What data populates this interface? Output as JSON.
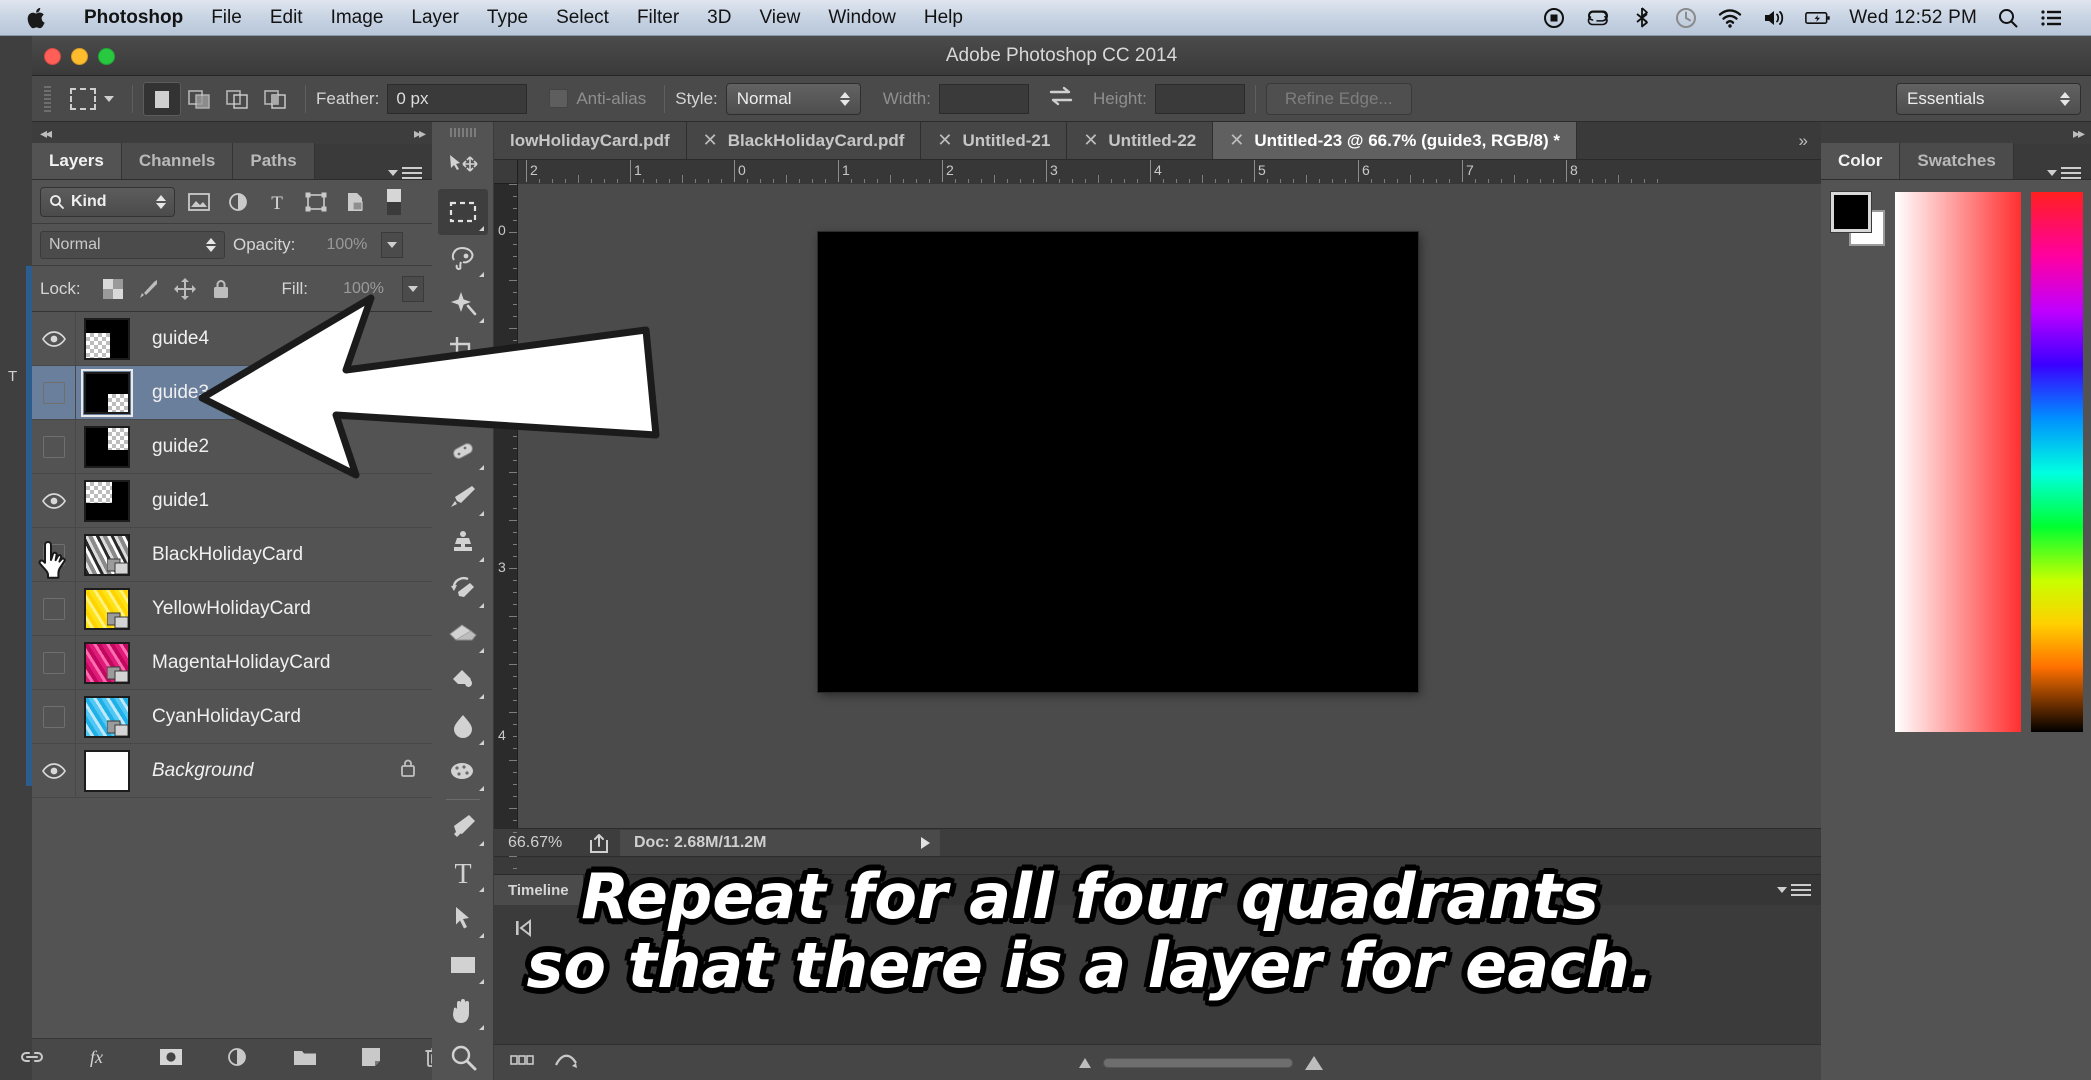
{
  "menubar": {
    "apple_icon": "apple-logo-icon",
    "items": [
      {
        "label": "Photoshop",
        "bold": true
      },
      {
        "label": "File",
        "bold": false
      },
      {
        "label": "Edit",
        "bold": false
      },
      {
        "label": "Image",
        "bold": false
      },
      {
        "label": "Layer",
        "bold": false
      },
      {
        "label": "Type",
        "bold": false
      },
      {
        "label": "Select",
        "bold": false
      },
      {
        "label": "Filter",
        "bold": false
      },
      {
        "label": "3D",
        "bold": false
      },
      {
        "label": "View",
        "bold": false
      },
      {
        "label": "Window",
        "bold": false
      },
      {
        "label": "Help",
        "bold": false
      }
    ],
    "status_icons": [
      "screen-record-icon",
      "creative-cloud-icon",
      "bluetooth-icon",
      "time-machine-icon",
      "wifi-icon",
      "volume-icon",
      "battery-icon"
    ],
    "clock": "Wed 12:52 PM",
    "search_icon": "spotlight-search-icon",
    "notifications_icon": "notification-center-icon"
  },
  "window": {
    "title": "Adobe Photoshop CC 2014",
    "close_label": "close",
    "minimize_label": "minimize",
    "zoom_label": "zoom"
  },
  "options_bar": {
    "tool_icon": "rectangular-marquee-icon",
    "tool_preset_caret": "chevron-down-icon",
    "selection_modes": [
      "new-selection-icon",
      "add-to-selection-icon",
      "subtract-from-selection-icon",
      "intersect-selection-icon"
    ],
    "feather_label": "Feather:",
    "feather_value": "0 px",
    "antialias_label": "Anti-alias",
    "antialias_checked": false,
    "style_label": "Style:",
    "style_value": "Normal",
    "width_label": "Width:",
    "width_value": "",
    "swap_icon": "swap-width-height-icon",
    "height_label": "Height:",
    "height_value": "",
    "refine_edge_label": "Refine Edge...",
    "workspace_value": "Essentials"
  },
  "layers_panel": {
    "collapse_left_icon": "collapse-left-icon",
    "expand_right_icon": "expand-right-icon",
    "tabs": [
      {
        "label": "Layers",
        "active": true
      },
      {
        "label": "Channels",
        "active": false
      },
      {
        "label": "Paths",
        "active": false
      }
    ],
    "menu_icon": "panel-menu-icon",
    "filter": {
      "kind_label": "Kind",
      "search_icon": "search-icon",
      "icons": [
        "pixel-layer-filter-icon",
        "adjustment-layer-filter-icon",
        "type-layer-filter-icon",
        "shape-layer-filter-icon",
        "smart-object-filter-icon"
      ],
      "toggle_icon": "filter-toggle-icon"
    },
    "blend_mode": "Normal",
    "opacity_label": "Opacity:",
    "opacity_value": "100%",
    "lock_label": "Lock:",
    "lock_icons": [
      "lock-transparency-icon",
      "lock-image-pixels-icon",
      "lock-position-icon",
      "lock-all-icon"
    ],
    "fill_label": "Fill:",
    "fill_value": "100%",
    "rows": [
      {
        "name": "guide4",
        "visible": true,
        "selected": false,
        "thumb": "black-with-transparent-top-left",
        "kind": "plain",
        "locked": false
      },
      {
        "name": "guide3",
        "visible": false,
        "selected": true,
        "thumb": "black-with-transparent-bottom-right",
        "kind": "plain",
        "locked": false
      },
      {
        "name": "guide2",
        "visible": false,
        "selected": false,
        "thumb": "black-with-transparent-top-right",
        "kind": "plain",
        "locked": false
      },
      {
        "name": "guide1",
        "visible": true,
        "selected": false,
        "thumb": "black-with-transparent-top-left-wide",
        "kind": "plain",
        "locked": false
      },
      {
        "name": "BlackHolidayCard",
        "visible": false,
        "selected": false,
        "thumb": "grayscale-photo",
        "kind": "smart-object",
        "locked": false
      },
      {
        "name": "YellowHolidayCard",
        "visible": false,
        "selected": false,
        "thumb": "yellow-photo",
        "kind": "smart-object",
        "locked": false
      },
      {
        "name": "MagentaHolidayCard",
        "visible": false,
        "selected": false,
        "thumb": "magenta-photo",
        "kind": "smart-object",
        "locked": false
      },
      {
        "name": "CyanHolidayCard",
        "visible": false,
        "selected": false,
        "thumb": "cyan-photo",
        "kind": "smart-object",
        "locked": false
      },
      {
        "name": "Background",
        "visible": true,
        "selected": false,
        "thumb": "white",
        "kind": "background",
        "locked": true
      }
    ],
    "footer_icons": [
      "link-layers-icon",
      "layer-style-fx-icon",
      "layer-mask-icon",
      "adjustment-layer-icon",
      "new-group-icon",
      "new-layer-icon",
      "delete-layer-icon"
    ]
  },
  "toolbox": {
    "tools": [
      {
        "icon": "move-tool-icon",
        "active": false,
        "has_flyout": false
      },
      {
        "icon": "rectangular-marquee-tool-icon",
        "active": true,
        "has_flyout": true
      },
      {
        "icon": "lasso-tool-icon",
        "active": false,
        "has_flyout": true
      },
      {
        "icon": "quick-selection-tool-icon",
        "active": false,
        "has_flyout": true
      },
      {
        "icon": "crop-tool-icon",
        "active": false,
        "has_flyout": true
      },
      {
        "icon": "eyedropper-tool-icon",
        "active": false,
        "has_flyout": true
      },
      {
        "icon": "spot-healing-brush-tool-icon",
        "active": false,
        "has_flyout": true
      },
      {
        "icon": "brush-tool-icon",
        "active": false,
        "has_flyout": true
      },
      {
        "icon": "clone-stamp-tool-icon",
        "active": false,
        "has_flyout": true
      },
      {
        "icon": "history-brush-tool-icon",
        "active": false,
        "has_flyout": true
      },
      {
        "icon": "eraser-tool-icon",
        "active": false,
        "has_flyout": true
      },
      {
        "icon": "gradient-tool-icon",
        "active": false,
        "has_flyout": true
      },
      {
        "icon": "blur-tool-icon",
        "active": false,
        "has_flyout": true
      },
      {
        "icon": "dodge-tool-icon",
        "active": false,
        "has_flyout": true
      },
      {
        "icon": "pen-tool-icon",
        "active": false,
        "has_flyout": true
      },
      {
        "icon": "type-tool-icon",
        "active": false,
        "has_flyout": true
      },
      {
        "icon": "path-selection-tool-icon",
        "active": false,
        "has_flyout": true
      },
      {
        "icon": "rectangle-tool-icon",
        "active": false,
        "has_flyout": true
      },
      {
        "icon": "hand-tool-icon",
        "active": false,
        "has_flyout": true
      },
      {
        "icon": "zoom-tool-icon",
        "active": false,
        "has_flyout": false
      }
    ]
  },
  "document_tabs": {
    "tabs": [
      {
        "label": "lowHolidayCard.pdf",
        "active": false,
        "closable": false
      },
      {
        "label": "BlackHolidayCard.pdf",
        "active": false,
        "closable": true
      },
      {
        "label": "Untitled-21",
        "active": false,
        "closable": true
      },
      {
        "label": "Untitled-22",
        "active": false,
        "closable": true
      },
      {
        "label": "Untitled-23 @ 66.7% (guide3, RGB/8) *",
        "active": true,
        "closable": true
      }
    ],
    "overflow_label": "»"
  },
  "rulers": {
    "horizontal_ticks": [
      "2",
      "1",
      "0",
      "1",
      "2",
      "3",
      "4",
      "5",
      "6",
      "7",
      "8"
    ],
    "vertical_ticks": [
      "0",
      "2",
      "3",
      "4"
    ],
    "unit": "inches"
  },
  "canvas": {
    "fill_color": "#000000",
    "description": "black document canvas"
  },
  "status_bar": {
    "zoom": "66.67%",
    "share_icon": "share-icon",
    "doc_info": "Doc: 2.68M/11.2M",
    "expand_icon": "play-triangle-icon"
  },
  "timeline_panel": {
    "tab_label": "Timeline",
    "menu_icon": "panel-menu-icon",
    "go_to_first_frame_icon": "go-to-first-frame-icon",
    "footer_icons": [
      "convert-to-frame-animation-icon",
      "transition-icon"
    ],
    "zoom_out_icon": "zoom-out-small-icon",
    "zoom_in_icon": "zoom-in-large-icon"
  },
  "color_panel": {
    "expand_right_icon": "expand-right-icon",
    "tabs": [
      {
        "label": "Color",
        "active": true
      },
      {
        "label": "Swatches",
        "active": false
      }
    ],
    "menu_icon": "panel-menu-icon",
    "foreground_color": "#000000",
    "background_color": "#ffffff",
    "ramp_label": "color-ramp",
    "hue_label": "hue-strip"
  },
  "annotation": {
    "arrow_icon": "white-arrow-pointing-left",
    "cursor_icon": "pointing-hand-cursor",
    "caption_line1": "Repeat for all four quadrants",
    "caption_line2": "so that there is a layer for each."
  }
}
